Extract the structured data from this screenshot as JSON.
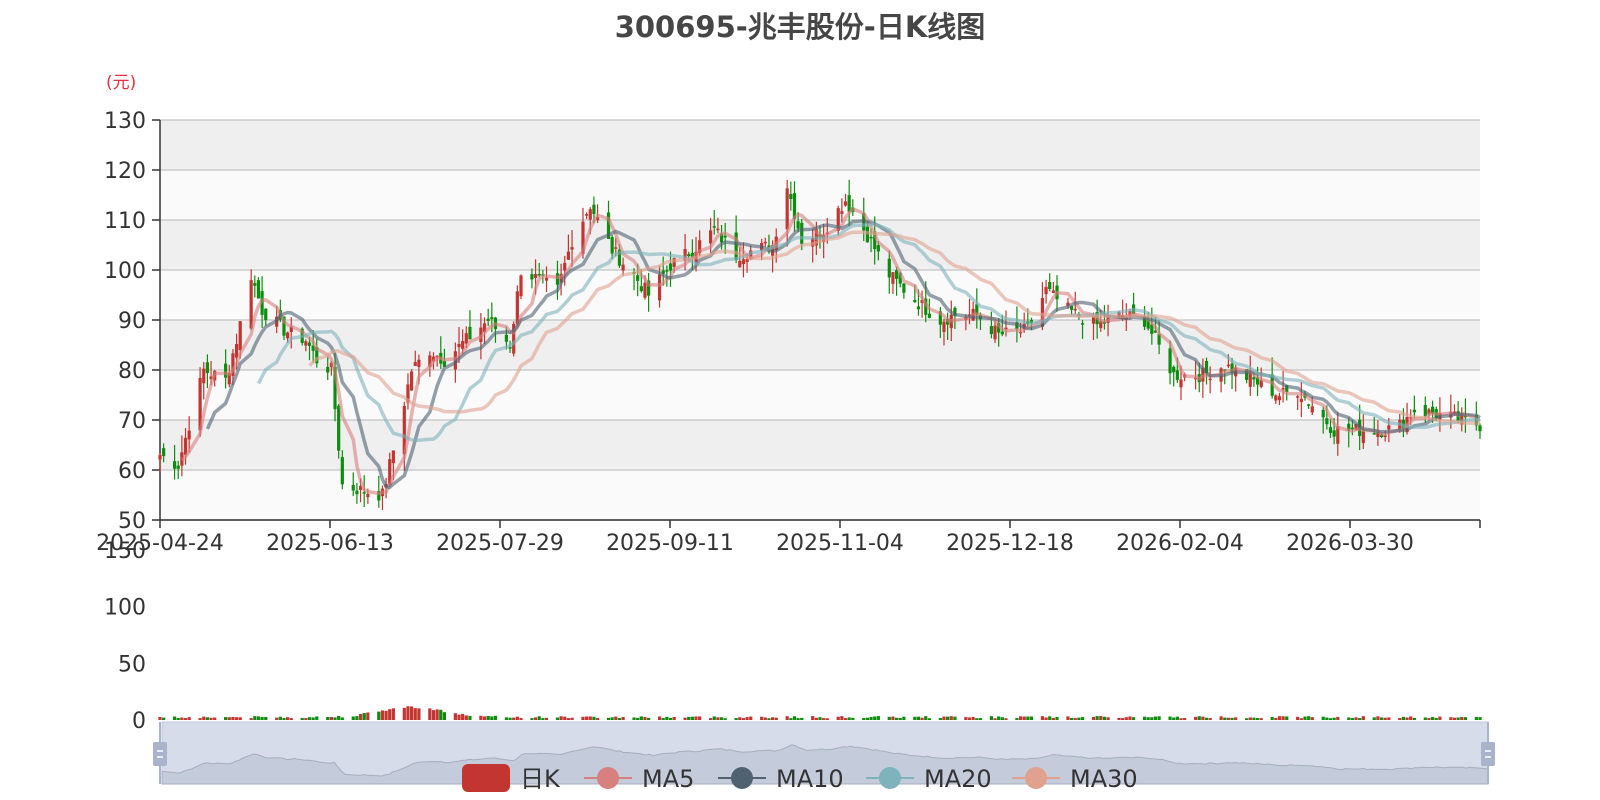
{
  "title": "300695-兆丰股份-日K线图",
  "chart_data": {
    "type": "candlestick",
    "unit": "(元)",
    "price_axis": {
      "ticks": [
        "130",
        "120",
        "110",
        "100",
        "90",
        "80",
        "70",
        "60",
        "50"
      ],
      "ylim": [
        50,
        130
      ]
    },
    "volume_axis": {
      "ticks": [
        "150",
        "100",
        "50",
        "0"
      ],
      "ylim": [
        0,
        150
      ]
    },
    "date_ticks": [
      "2025-04-24",
      "2025-06-13",
      "2025-07-29",
      "2025-09-11",
      "2025-11-04",
      "2025-12-18",
      "2026-02-04",
      "2026-03-30"
    ],
    "x_range": [
      "2025-04-24",
      "2026-04-21"
    ],
    "up_color": "#c23531",
    "down_color": "#0d8d0d",
    "legend": [
      "日K",
      "MA5",
      "MA10",
      "MA20",
      "MA30"
    ],
    "ma_colors": {
      "MA5": "#d7807f",
      "MA10": "#4f6272",
      "MA20": "#7fb3bb",
      "MA30": "#e0a18e"
    },
    "close_path": [
      [
        "2025-04-24",
        63
      ],
      [
        "2025-04-29",
        61
      ],
      [
        "2025-05-06",
        80
      ],
      [
        "2025-05-12",
        78
      ],
      [
        "2025-05-15",
        86
      ],
      [
        "2025-05-19",
        99
      ],
      [
        "2025-05-22",
        92
      ],
      [
        "2025-05-28",
        88
      ],
      [
        "2025-06-03",
        86
      ],
      [
        "2025-06-06",
        82
      ],
      [
        "2025-06-10",
        80
      ],
      [
        "2025-06-13",
        57
      ],
      [
        "2025-06-18",
        56
      ],
      [
        "2025-06-24",
        55
      ],
      [
        "2025-06-27",
        64
      ],
      [
        "2025-07-02",
        80
      ],
      [
        "2025-07-07",
        84
      ],
      [
        "2025-07-11",
        82
      ],
      [
        "2025-07-17",
        86
      ],
      [
        "2025-07-23",
        90
      ],
      [
        "2025-07-29",
        85
      ],
      [
        "2025-08-01",
        100
      ],
      [
        "2025-08-06",
        98
      ],
      [
        "2025-08-11",
        96
      ],
      [
        "2025-08-15",
        106
      ],
      [
        "2025-08-20",
        113
      ],
      [
        "2025-08-26",
        104
      ],
      [
        "2025-09-01",
        99
      ],
      [
        "2025-09-05",
        95
      ],
      [
        "2025-09-11",
        101
      ],
      [
        "2025-09-17",
        104
      ],
      [
        "2025-09-23",
        108
      ],
      [
        "2025-09-29",
        103
      ],
      [
        "2025-10-09",
        105
      ],
      [
        "2025-10-13",
        117
      ],
      [
        "2025-10-17",
        106
      ],
      [
        "2025-10-23",
        108
      ],
      [
        "2025-10-29",
        114
      ],
      [
        "2025-11-04",
        107
      ],
      [
        "2025-11-10",
        99
      ],
      [
        "2025-11-17",
        94
      ],
      [
        "2025-11-24",
        90
      ],
      [
        "2025-11-28",
        91
      ],
      [
        "2025-12-04",
        91
      ],
      [
        "2025-12-10",
        87
      ],
      [
        "2025-12-18",
        88
      ],
      [
        "2025-12-23",
        96
      ],
      [
        "2025-12-29",
        92
      ],
      [
        "2026-01-06",
        89
      ],
      [
        "2026-01-13",
        91
      ],
      [
        "2026-01-19",
        90
      ],
      [
        "2026-01-22",
        86
      ],
      [
        "2026-01-27",
        79
      ],
      [
        "2026-02-04",
        79
      ],
      [
        "2026-02-10",
        81
      ],
      [
        "2026-02-25",
        75
      ],
      [
        "2026-03-02",
        76
      ],
      [
        "2026-03-06",
        73
      ],
      [
        "2026-03-12",
        68
      ],
      [
        "2026-03-19",
        68
      ],
      [
        "2026-03-26",
        68
      ],
      [
        "2026-03-30",
        69
      ],
      [
        "2026-04-03",
        72
      ],
      [
        "2026-04-10",
        71
      ],
      [
        "2026-04-16",
        70
      ],
      [
        "2026-04-21",
        69
      ]
    ],
    "volume_peak_date": "2025-07-02"
  }
}
